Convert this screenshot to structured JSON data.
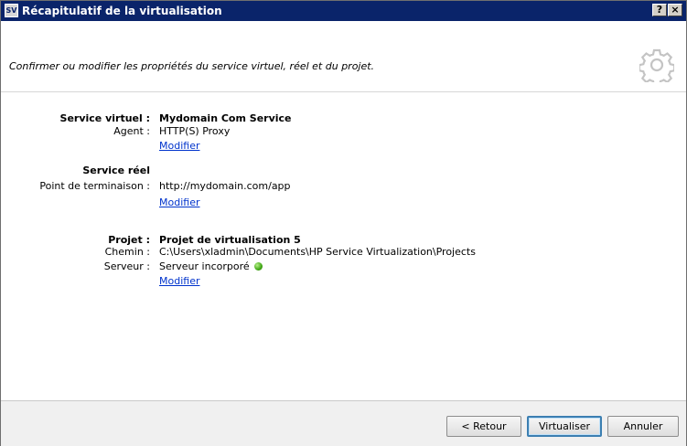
{
  "window": {
    "title": "Récapitulatif de la virtualisation",
    "icon_label": "SV",
    "help_label": "?",
    "close_label": "×"
  },
  "header": {
    "instruction": "Confirmer ou modifier les propriétés du service virtuel, réel et du projet.",
    "icon": "gear-icon"
  },
  "virtual_service": {
    "label": "Service virtuel :",
    "name": "Mydomain Com Service",
    "agent_label": "Agent :",
    "agent_value": "HTTP(S) Proxy",
    "modify_link": "Modifier"
  },
  "real_service": {
    "label": "Service réel",
    "endpoint_label": "Point de terminaison :",
    "endpoint_value": "http://mydomain.com/app",
    "modify_link": "Modifier"
  },
  "project": {
    "label": "Projet :",
    "name": "Projet de virtualisation 5",
    "path_label": "Chemin :",
    "path_value": "C:\\Users\\xladmin\\Documents\\HP Service Virtualization\\Projects",
    "server_label": "Serveur :",
    "server_value": "Serveur incorporé",
    "server_status_color": "#3fa614",
    "modify_link": "Modifier"
  },
  "footer": {
    "back_label": "< Retour",
    "virtualize_label": "Virtualiser",
    "cancel_label": "Annuler"
  },
  "colors": {
    "titlebar": "#0a246a",
    "link": "#0033cc",
    "footer_bg": "#f0f0f0"
  }
}
